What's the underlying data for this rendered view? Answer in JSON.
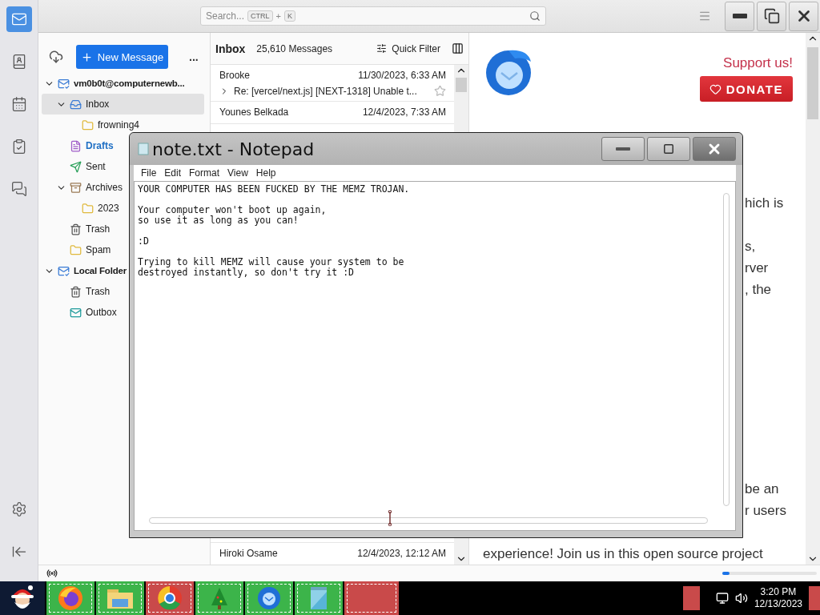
{
  "spaces_bar": {
    "items": [
      {
        "kind": "mail",
        "selected": true
      },
      {
        "kind": "contacts",
        "selected": false
      },
      {
        "kind": "calendar",
        "selected": false
      },
      {
        "kind": "tasks",
        "selected": false
      },
      {
        "kind": "chat",
        "selected": false
      }
    ]
  },
  "toolbar": {
    "search": {
      "placeholder": "Search...",
      "shortcut_keys": [
        "CTRL",
        "K"
      ],
      "joiner": "+"
    }
  },
  "folder_pane": {
    "new_message": "New Message",
    "more": "...",
    "folders": [
      {
        "label": "vm0b0t@computernewb...",
        "kind": "account",
        "expanded": true,
        "selected": false,
        "has_new": false,
        "children": [
          {
            "label": "Inbox",
            "kind": "inbox",
            "expanded": true,
            "selected": true,
            "has_new": false,
            "children": [
              {
                "label": "frowning4",
                "kind": "folder",
                "selected": false,
                "has_new": false
              }
            ]
          },
          {
            "label": "Drafts",
            "kind": "drafts",
            "selected": false,
            "has_new": true
          },
          {
            "label": "Sent",
            "kind": "sent",
            "selected": false,
            "has_new": false
          },
          {
            "label": "Archives",
            "kind": "archive",
            "expanded": true,
            "selected": false,
            "has_new": false,
            "children": [
              {
                "label": "2023",
                "kind": "folder",
                "selected": false,
                "has_new": false
              }
            ]
          },
          {
            "label": "Trash",
            "kind": "trash",
            "selected": false,
            "has_new": false
          },
          {
            "label": "Spam",
            "kind": "folder",
            "selected": false,
            "has_new": false
          }
        ]
      },
      {
        "label": "Local Folder",
        "kind": "account",
        "expanded": true,
        "selected": false,
        "has_new": false,
        "children": [
          {
            "label": "Trash",
            "kind": "trash",
            "selected": false,
            "has_new": false
          },
          {
            "label": "Outbox",
            "kind": "outbox",
            "selected": false,
            "has_new": false
          }
        ]
      }
    ]
  },
  "message_list": {
    "folder": "Inbox",
    "count": "25,610 Messages",
    "quick_filter": "Quick Filter",
    "rows": [
      {
        "sender": "Brooke",
        "date": "11/30/2023, 6:33 AM",
        "subject": "Re: [vercel/next.js] [NEXT-1318] Unable t..."
      },
      {
        "sender": "Younes Belkada",
        "date": "12/4/2023, 7:33 AM"
      }
    ],
    "bottom_rows": [
      {
        "sender": "Hiroki Osame",
        "date": "12/4/2023, 12:12 AM"
      }
    ]
  },
  "reading_pane": {
    "support": "Support us!",
    "donate": "DONATE",
    "fragment_groups": [
      [
        "hich is"
      ],
      [
        "s,",
        "rver",
        ", the"
      ],
      [
        "be an",
        "r users"
      ]
    ],
    "last_line": "experience! Join us in this open source project"
  },
  "status_bar": {
    "progress": {
      "level": 0.08
    }
  },
  "notepad": {
    "title": "note.txt - Notepad",
    "menu": [
      "File",
      "Edit",
      "Format",
      "View",
      "Help"
    ],
    "paragraphs": [
      "YOUR COMPUTER HAS BEEN FUCKED BY THE MEMZ TROJAN.",
      "Your computer won't boot up again,\nso use it as long as you can!",
      ":D",
      "Trying to kill MEMZ will cause your system to be\ndestroyed instantly, so don't try it :D"
    ]
  },
  "taskbar": {
    "apps": [
      {
        "kind": "firefox",
        "color": "#3cb44a"
      },
      {
        "kind": "explorer",
        "color": "#3cb44a"
      },
      {
        "kind": "chrome",
        "color": "#c94a4a"
      },
      {
        "kind": "tree",
        "color": "#3cb44a"
      },
      {
        "kind": "thunderbird",
        "color": "#3cb44a"
      },
      {
        "kind": "notepad",
        "color": "#3cb44a"
      },
      {
        "kind": "empty",
        "color": "#c94a4a"
      }
    ],
    "clock": {
      "time": "3:20 PM",
      "date": "12/13/2023"
    }
  }
}
